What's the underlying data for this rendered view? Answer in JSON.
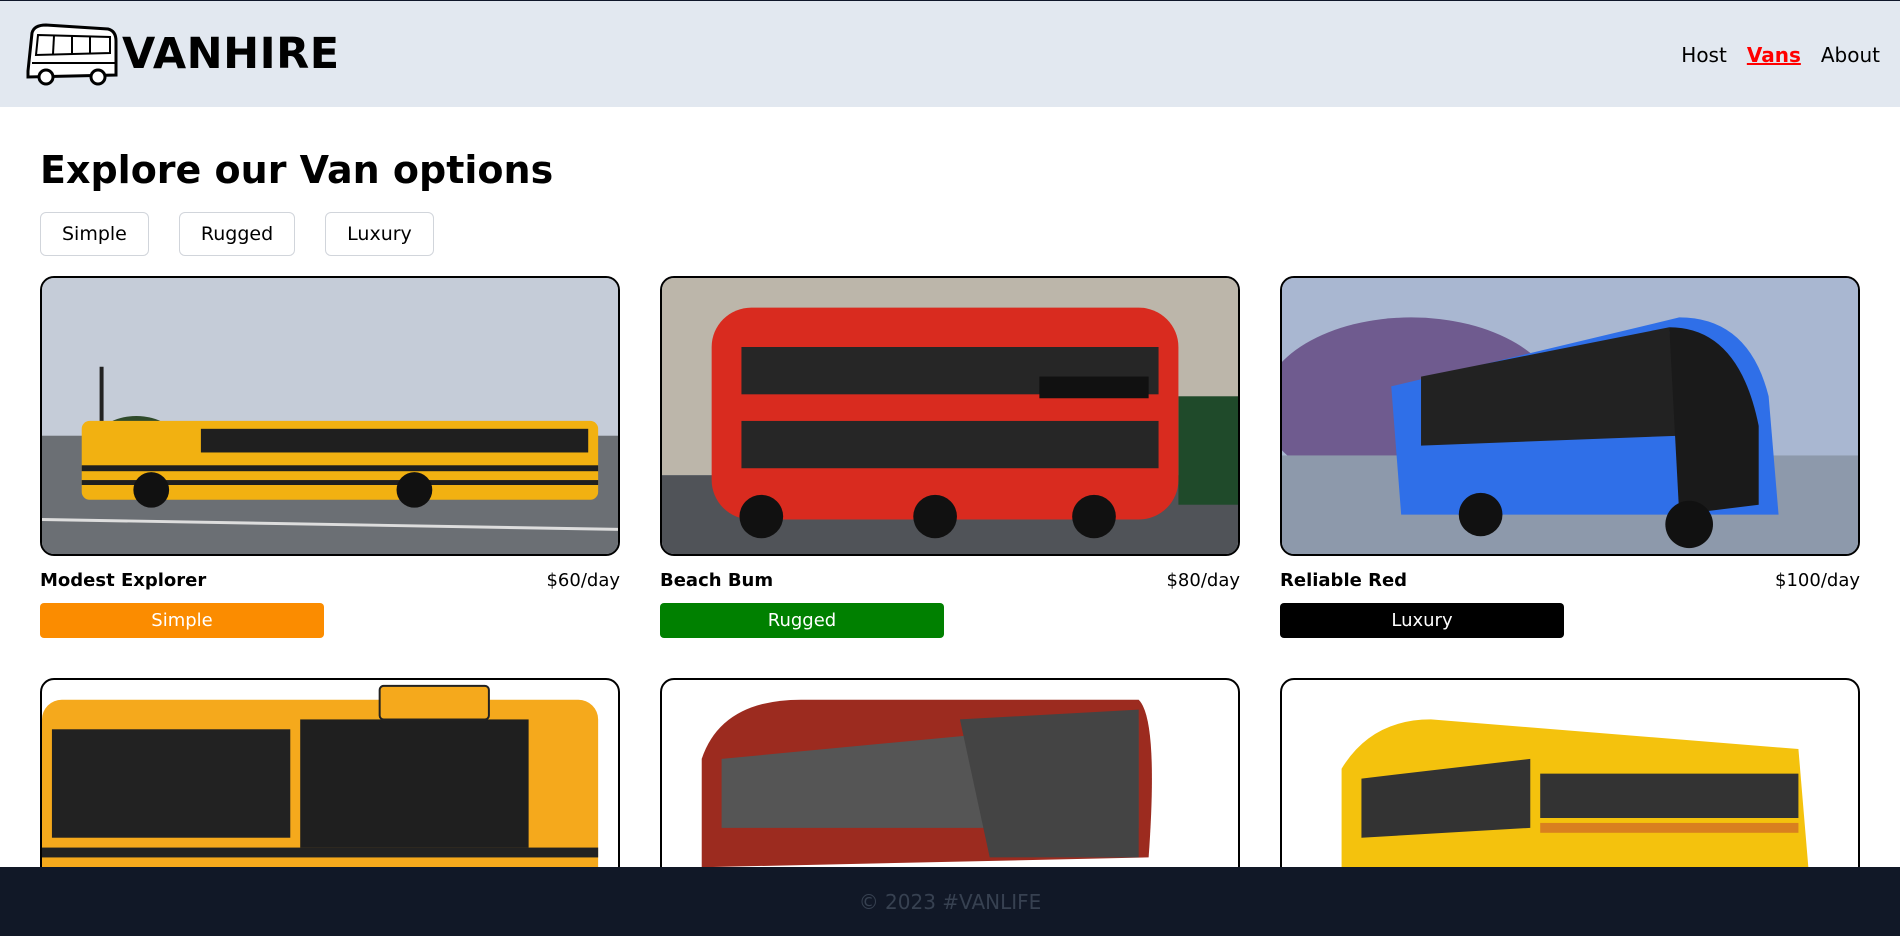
{
  "brand": {
    "name": "VANHIRE"
  },
  "nav": {
    "host": "Host",
    "vans": "Vans",
    "about": "About"
  },
  "page": {
    "title": "Explore our Van options"
  },
  "filters": [
    "Simple",
    "Rugged",
    "Luxury"
  ],
  "vans": [
    {
      "name": "Modest Explorer",
      "price": "$60/day",
      "type": "Simple",
      "color": "#fb8c00"
    },
    {
      "name": "Beach Bum",
      "price": "$80/day",
      "type": "Rugged",
      "color": "#008000"
    },
    {
      "name": "Reliable Red",
      "price": "$100/day",
      "type": "Luxury",
      "color": "#000000"
    }
  ],
  "footer": {
    "text": "© 2023 #VANLIFE"
  }
}
